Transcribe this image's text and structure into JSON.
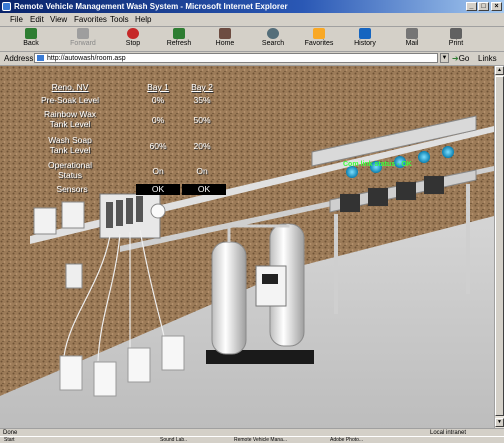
{
  "window": {
    "title": "Remote Vehicle Management Wash System - Microsoft Internet Explorer",
    "min": "_",
    "max": "□",
    "close": "×"
  },
  "menu": [
    "File",
    "Edit",
    "View",
    "Favorites",
    "Tools",
    "Help"
  ],
  "toolbar": [
    {
      "label": "Back",
      "icon": "back-arrow-icon",
      "color": "#2e7d32",
      "enabled": true
    },
    {
      "label": "Forward",
      "icon": "forward-arrow-icon",
      "color": "#9e9e9e",
      "enabled": false
    },
    {
      "label": "Stop",
      "icon": "stop-icon",
      "color": "#c62828",
      "enabled": true
    },
    {
      "label": "Refresh",
      "icon": "refresh-icon",
      "color": "#2e7d32",
      "enabled": true
    },
    {
      "label": "Home",
      "icon": "home-icon",
      "color": "#6d4c41",
      "enabled": true
    },
    {
      "label": "Search",
      "icon": "search-icon",
      "color": "#546e7a",
      "enabled": true
    },
    {
      "label": "Favorites",
      "icon": "favorites-icon",
      "color": "#f9a825",
      "enabled": true
    },
    {
      "label": "History",
      "icon": "history-icon",
      "color": "#1565c0",
      "enabled": true
    },
    {
      "label": "Mail",
      "icon": "mail-icon",
      "color": "#757575",
      "enabled": true
    },
    {
      "label": "Print",
      "icon": "print-icon",
      "color": "#616161",
      "enabled": true
    }
  ],
  "address": {
    "label": "Address",
    "url": "http://autowash/room.asp",
    "go": "Go",
    "links": "Links"
  },
  "panel": {
    "location": "Reno, NV",
    "bay1": "Bay 1",
    "bay2": "Bay 2",
    "rows": [
      {
        "label": "Pre-Soak Level",
        "bay1": "0%",
        "bay2": "35%"
      },
      {
        "label": "Rainbow Wax Tank Level",
        "bay1": "0%",
        "bay2": "50%"
      },
      {
        "label": "Wash Soap Tank Level",
        "bay1": "60%",
        "bay2": "20%"
      },
      {
        "label": "Operational Status",
        "bay1": "On",
        "bay2": "On"
      }
    ],
    "sensors": {
      "label": "Sensors",
      "bay1": "OK",
      "bay2": "OK"
    },
    "comm_link": "Com link status - OK"
  },
  "status_bar": {
    "left": "Done",
    "right": "Local intranet"
  },
  "taskbar": [
    "Start",
    "Sound Lab..",
    "Remote Vehicle Mana...",
    "Adobe Photo..."
  ],
  "colors": {
    "comm": "#3cff3c",
    "wall": "#9a7a58",
    "floor": "#d8d8d8",
    "accent": "#0a246a"
  }
}
